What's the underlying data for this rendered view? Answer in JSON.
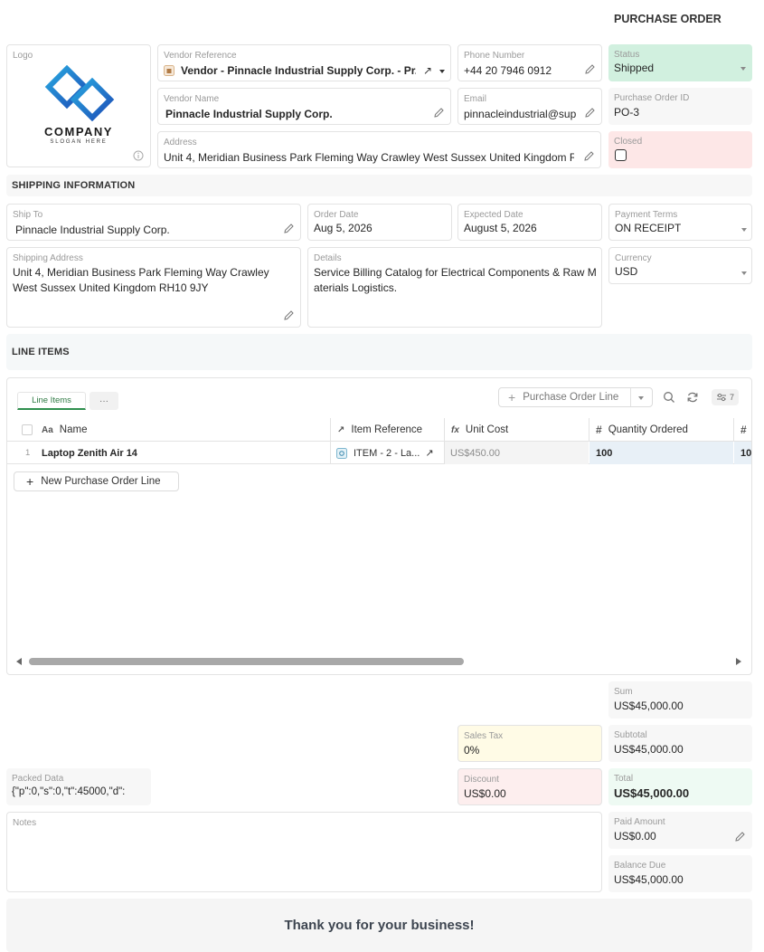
{
  "header": {
    "title": "PURCHASE ORDER"
  },
  "logo": {
    "label": "Logo",
    "company": "COMPANY",
    "slogan": "SLOGAN HERE"
  },
  "vendor_reference": {
    "label": "Vendor Reference",
    "value": "Vendor - Pinnacle Industrial Supply Corp. - Pr..."
  },
  "vendor_name": {
    "label": "Vendor Name",
    "value": "Pinnacle Industrial Supply Corp."
  },
  "address": {
    "label": "Address",
    "value": "Unit 4, Meridian Business Park Fleming Way Crawley West Sussex United Kingdom R"
  },
  "phone": {
    "label": "Phone Number",
    "value": "+44 20 7946 0912"
  },
  "email": {
    "label": "Email",
    "value": "pinnacleindustrial@sup"
  },
  "status": {
    "label": "Status",
    "value": "Shipped",
    "color": "#d1f0df"
  },
  "po_id": {
    "label": "Purchase Order ID",
    "value": "PO-3"
  },
  "closed": {
    "label": "Closed",
    "color": "#fde7e7"
  },
  "shipping": {
    "heading": "SHIPPING INFORMATION",
    "ship_to": {
      "label": "Ship To",
      "value": "Pinnacle Industrial Supply Corp."
    },
    "order_date": {
      "label": "Order Date",
      "value": "Aug 5, 2026"
    },
    "expected_date": {
      "label": "Expected Date",
      "value": "August 5, 2026"
    },
    "payment_terms": {
      "label": "Payment Terms",
      "value": "ON RECEIPT"
    },
    "shipping_address": {
      "label": "Shipping Address",
      "value": "Unit 4, Meridian Business Park Fleming Way Crawley West Sussex United Kingdom RH10 9JY"
    },
    "details": {
      "label": "Details",
      "value": "Service Billing Catalog for Electrical Components & Raw Materials Logistics."
    },
    "currency": {
      "label": "Currency",
      "value": "USD"
    }
  },
  "line_items": {
    "heading": "LINE ITEMS",
    "tab": "Line Items",
    "more": "···",
    "add_button": "Purchase Order Line",
    "filter_count": "7",
    "columns": {
      "name": {
        "icon": "Aa",
        "label": "Name"
      },
      "item_ref": {
        "icon": "↗",
        "label": "Item Reference"
      },
      "unit_cost": {
        "icon": "fx",
        "label": "Unit Cost"
      },
      "qty": {
        "icon": "#",
        "label": "Quantity Ordered"
      },
      "next": {
        "icon": "#"
      }
    },
    "rows": [
      {
        "num": "1",
        "name": "Laptop Zenith Air 14",
        "item_ref": "ITEM - 2 - La...",
        "unit_cost": "US$450.00",
        "qty": "100",
        "next": "10"
      }
    ],
    "new_line": "New Purchase Order Line",
    "scroll_fraction": 0.62
  },
  "totals": {
    "sum": {
      "label": "Sum",
      "value": "US$45,000.00"
    },
    "subtotal": {
      "label": "Subtotal",
      "value": "US$45,000.00"
    },
    "sales_tax": {
      "label": "Sales Tax",
      "value": "0%",
      "color": "#fffbe6"
    },
    "discount": {
      "label": "Discount",
      "value": "US$0.00",
      "color": "#fdeeee"
    },
    "total": {
      "label": "Total",
      "value": "US$45,000.00",
      "color": "#eefaf3"
    },
    "paid": {
      "label": "Paid Amount",
      "value": "US$0.00"
    },
    "balance": {
      "label": "Balance Due",
      "value": "US$45,000.00"
    }
  },
  "packed": {
    "label": "Packed Data",
    "value": "{\"p\":0,\"s\":0,\"t\":45000,\"d\":"
  },
  "notes": {
    "label": "Notes"
  },
  "footer": {
    "text": "Thank you for your business!"
  }
}
